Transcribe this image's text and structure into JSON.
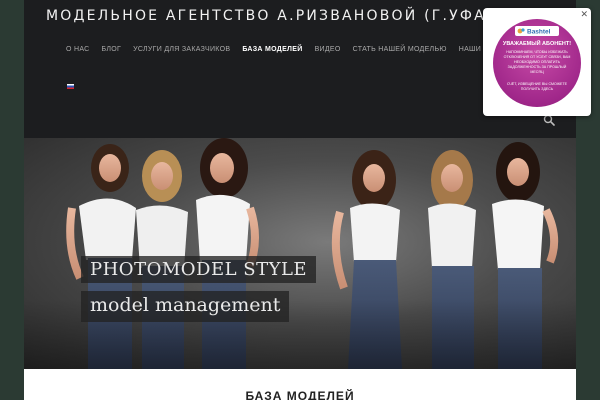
{
  "header": {
    "site_title": "МОДЕЛЬНОЕ АГЕНТСТВО А.РИЗВАНОВОЙ (Г.УФА)",
    "nav": [
      {
        "label": "О НАС"
      },
      {
        "label": "БЛОГ"
      },
      {
        "label": "УСЛУГИ ДЛЯ ЗАКАЗЧИКОВ"
      },
      {
        "label": "БАЗА МОДЕЛЕЙ",
        "active": true
      },
      {
        "label": "ВИДЕО"
      },
      {
        "label": "СТАТЬ НАШЕЙ МОДЕЛЬЮ"
      },
      {
        "label": "НАШИ КОНТАКТЫ"
      }
    ],
    "language_flag": "ru-flag-icon",
    "search_icon": "search-icon"
  },
  "banner": {
    "caption_line1": "PHOTOMODEL STYLE",
    "caption_line2": "model management"
  },
  "content": {
    "section_title": "БАЗА МОДЕЛЕЙ"
  },
  "popup": {
    "logo_text": "Bashtel",
    "heading": "УВАЖАЕМЫЙ АБОНЕНТ!",
    "body": "НАПОМИНАЕМ, ЧТОБЫ ИЗБЕЖАТЬ ОТКЛЮЧЕНИЯ ОТ УСЛУГ СВЯЗИ, ВАМ НЕОБХОДИМО ОПЛАТИТЬ ЗАДОЛЖЕННОСТЬ ЗА ПРОШЛЫЙ МЕСЯЦ",
    "link": "СЧЁТ, ИЗВЕЩЕНИЕ ВЫ СМОЖЕТЕ ПОЛУЧИТЬ ЗДЕСЬ",
    "close": "✕"
  },
  "colors": {
    "page_bg": "#2b3a33",
    "header_bg": "#1c1d1f",
    "popup_accent": "#a0278a"
  }
}
